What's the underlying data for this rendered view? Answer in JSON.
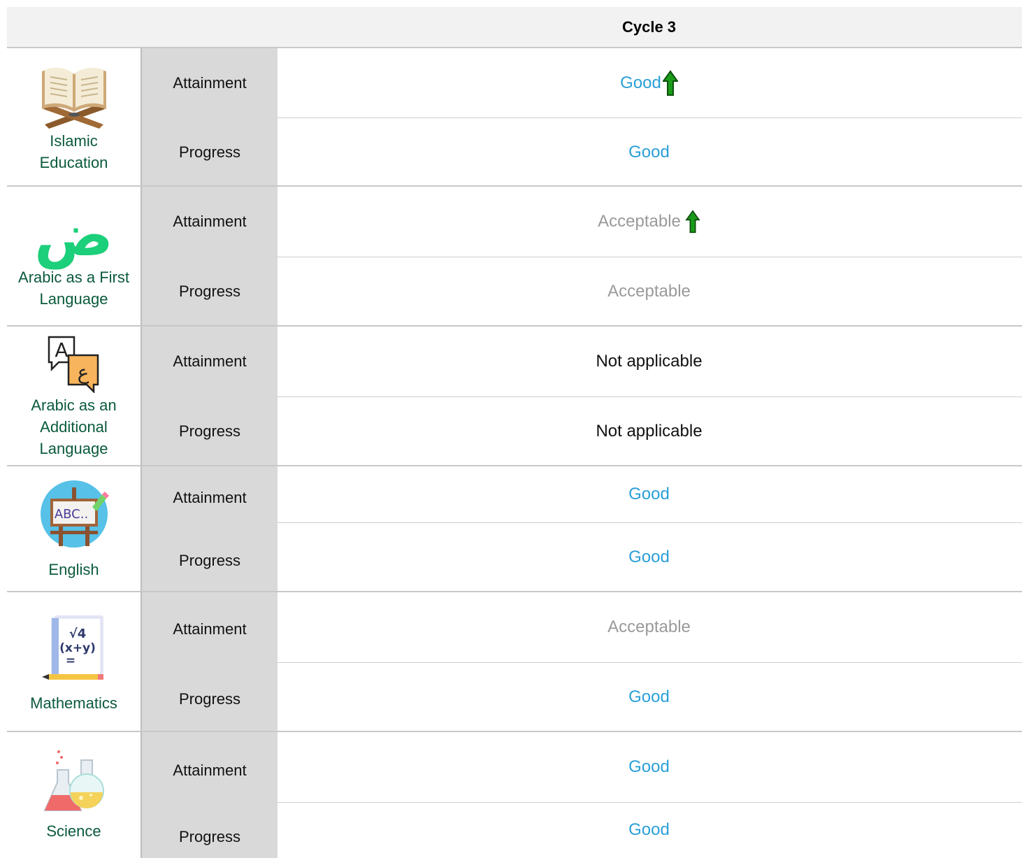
{
  "header": {
    "cycle_label": "Cycle 3"
  },
  "colors": {
    "good": "#2b9fd8",
    "acceptable": "#9a9a9a",
    "subject": "#0b5a3c",
    "arrow_up": "#1a9c1a"
  },
  "subjects": [
    {
      "name": "Islamic Education",
      "icon": "quran-book-icon",
      "attainment": {
        "label": "Attainment",
        "value": "Good",
        "trend": "up"
      },
      "progress": {
        "label": "Progress",
        "value": "Good"
      }
    },
    {
      "name": "Arabic as a First Language",
      "icon": "arabic-letter-icon",
      "attainment": {
        "label": "Attainment",
        "value": "Acceptable",
        "trend": "up"
      },
      "progress": {
        "label": "Progress",
        "value": "Acceptable"
      }
    },
    {
      "name": "Arabic as an Additional Language",
      "icon": "translate-speech-icon",
      "attainment": {
        "label": "Attainment",
        "value": "Not applicable"
      },
      "progress": {
        "label": "Progress",
        "value": "Not applicable"
      }
    },
    {
      "name": "English",
      "icon": "abc-easel-icon",
      "attainment": {
        "label": "Attainment",
        "value": "Good"
      },
      "progress": {
        "label": "Progress",
        "value": "Good"
      }
    },
    {
      "name": "Mathematics",
      "icon": "math-notebook-icon",
      "attainment": {
        "label": "Attainment",
        "value": "Acceptable"
      },
      "progress": {
        "label": "Progress",
        "value": "Good"
      }
    },
    {
      "name": "Science",
      "icon": "flasks-icon",
      "attainment": {
        "label": "Attainment",
        "value": "Good"
      },
      "progress": {
        "label": "Progress",
        "value": "Good"
      }
    }
  ]
}
